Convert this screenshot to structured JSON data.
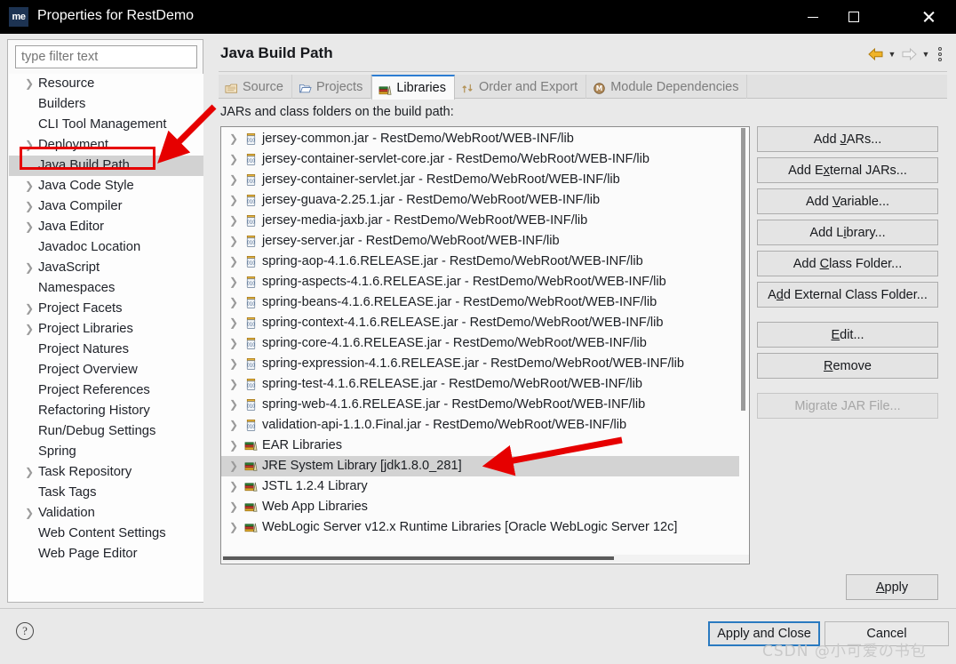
{
  "window": {
    "title": "Properties for RestDemo",
    "icon_label": "me",
    "controls": {
      "minimize": "minimize-icon",
      "maximize": "maximize-icon",
      "close": "close-icon"
    }
  },
  "sidebar": {
    "filter_placeholder": "type filter text",
    "items": [
      {
        "label": "Resource",
        "expandable": true,
        "selected": false
      },
      {
        "label": "Builders",
        "expandable": false,
        "selected": false
      },
      {
        "label": "CLI Tool Management",
        "expandable": false,
        "selected": false
      },
      {
        "label": "Deployment",
        "expandable": true,
        "selected": false
      },
      {
        "label": "Java Build Path",
        "expandable": false,
        "selected": true
      },
      {
        "label": "Java Code Style",
        "expandable": true,
        "selected": false
      },
      {
        "label": "Java Compiler",
        "expandable": true,
        "selected": false
      },
      {
        "label": "Java Editor",
        "expandable": true,
        "selected": false
      },
      {
        "label": "Javadoc Location",
        "expandable": false,
        "selected": false
      },
      {
        "label": "JavaScript",
        "expandable": true,
        "selected": false
      },
      {
        "label": "Namespaces",
        "expandable": false,
        "selected": false
      },
      {
        "label": "Project Facets",
        "expandable": true,
        "selected": false
      },
      {
        "label": "Project Libraries",
        "expandable": true,
        "selected": false
      },
      {
        "label": "Project Natures",
        "expandable": false,
        "selected": false
      },
      {
        "label": "Project Overview",
        "expandable": false,
        "selected": false
      },
      {
        "label": "Project References",
        "expandable": false,
        "selected": false
      },
      {
        "label": "Refactoring History",
        "expandable": false,
        "selected": false
      },
      {
        "label": "Run/Debug Settings",
        "expandable": false,
        "selected": false
      },
      {
        "label": "Spring",
        "expandable": false,
        "selected": false
      },
      {
        "label": "Task Repository",
        "expandable": true,
        "selected": false
      },
      {
        "label": "Task Tags",
        "expandable": false,
        "selected": false
      },
      {
        "label": "Validation",
        "expandable": true,
        "selected": false
      },
      {
        "label": "Web Content Settings",
        "expandable": false,
        "selected": false
      },
      {
        "label": "Web Page Editor",
        "expandable": false,
        "selected": false
      }
    ]
  },
  "main": {
    "page_title": "Java Build Path",
    "nav": {
      "back": "back-arrow-icon",
      "forward": "forward-arrow-icon",
      "menu": "view-menu-icon"
    },
    "tabs": [
      {
        "label": "Source",
        "icon": "source-folder-icon",
        "active": false
      },
      {
        "label": "Projects",
        "icon": "projects-folder-icon",
        "active": false
      },
      {
        "label": "Libraries",
        "icon": "libraries-books-icon",
        "active": true
      },
      {
        "label": "Order and Export",
        "icon": "order-export-icon",
        "active": false
      },
      {
        "label": "Module Dependencies",
        "icon": "module-dependencies-icon",
        "active": false
      }
    ],
    "list_label": "JARs and class folders on the build path:",
    "entries": [
      {
        "label": "jersey-common.jar - RestDemo/WebRoot/WEB-INF/lib",
        "icon": "jar-icon",
        "selected": false
      },
      {
        "label": "jersey-container-servlet-core.jar - RestDemo/WebRoot/WEB-INF/lib",
        "icon": "jar-icon",
        "selected": false
      },
      {
        "label": "jersey-container-servlet.jar - RestDemo/WebRoot/WEB-INF/lib",
        "icon": "jar-icon",
        "selected": false
      },
      {
        "label": "jersey-guava-2.25.1.jar - RestDemo/WebRoot/WEB-INF/lib",
        "icon": "jar-icon",
        "selected": false
      },
      {
        "label": "jersey-media-jaxb.jar - RestDemo/WebRoot/WEB-INF/lib",
        "icon": "jar-icon",
        "selected": false
      },
      {
        "label": "jersey-server.jar - RestDemo/WebRoot/WEB-INF/lib",
        "icon": "jar-icon",
        "selected": false
      },
      {
        "label": "spring-aop-4.1.6.RELEASE.jar - RestDemo/WebRoot/WEB-INF/lib",
        "icon": "jar-icon",
        "selected": false
      },
      {
        "label": "spring-aspects-4.1.6.RELEASE.jar - RestDemo/WebRoot/WEB-INF/lib",
        "icon": "jar-icon",
        "selected": false
      },
      {
        "label": "spring-beans-4.1.6.RELEASE.jar - RestDemo/WebRoot/WEB-INF/lib",
        "icon": "jar-icon",
        "selected": false
      },
      {
        "label": "spring-context-4.1.6.RELEASE.jar - RestDemo/WebRoot/WEB-INF/lib",
        "icon": "jar-icon",
        "selected": false
      },
      {
        "label": "spring-core-4.1.6.RELEASE.jar - RestDemo/WebRoot/WEB-INF/lib",
        "icon": "jar-icon",
        "selected": false
      },
      {
        "label": "spring-expression-4.1.6.RELEASE.jar - RestDemo/WebRoot/WEB-INF/lib",
        "icon": "jar-icon",
        "selected": false
      },
      {
        "label": "spring-test-4.1.6.RELEASE.jar - RestDemo/WebRoot/WEB-INF/lib",
        "icon": "jar-icon",
        "selected": false
      },
      {
        "label": "spring-web-4.1.6.RELEASE.jar - RestDemo/WebRoot/WEB-INF/lib",
        "icon": "jar-icon",
        "selected": false
      },
      {
        "label": "validation-api-1.1.0.Final.jar - RestDemo/WebRoot/WEB-INF/lib",
        "icon": "jar-icon",
        "selected": false
      },
      {
        "label": "EAR Libraries",
        "icon": "library-books-icon",
        "selected": false
      },
      {
        "label": "JRE System Library [jdk1.8.0_281]",
        "icon": "library-books-icon",
        "selected": true
      },
      {
        "label": "JSTL 1.2.4 Library",
        "icon": "library-books-icon",
        "selected": false
      },
      {
        "label": "Web App Libraries",
        "icon": "library-books-icon",
        "selected": false
      },
      {
        "label": "WebLogic Server v12.x Runtime Libraries [Oracle WebLogic Server 12c]",
        "icon": "library-books-icon",
        "selected": false
      }
    ],
    "side_buttons": [
      {
        "label": "Add JARs...",
        "mnemonic": "J",
        "enabled": true
      },
      {
        "label": "Add External JARs...",
        "mnemonic": "x",
        "enabled": true
      },
      {
        "label": "Add Variable...",
        "mnemonic": "V",
        "enabled": true
      },
      {
        "label": "Add Library...",
        "mnemonic": "i",
        "enabled": true
      },
      {
        "label": "Add Class Folder...",
        "mnemonic": "C",
        "enabled": true
      },
      {
        "label": "Add External Class Folder...",
        "mnemonic": "d",
        "enabled": true
      },
      {
        "label": "Edit...",
        "mnemonic": "E",
        "enabled": true
      },
      {
        "label": "Remove",
        "mnemonic": "R",
        "enabled": true
      },
      {
        "label": "Migrate JAR File...",
        "mnemonic": "",
        "enabled": false
      }
    ],
    "apply_button": {
      "label": "Apply",
      "mnemonic": "A"
    }
  },
  "footer": {
    "help_icon": "help-icon",
    "apply_and_close": "Apply and Close",
    "cancel": "Cancel"
  },
  "watermark": "CSDN @小可爱の书包",
  "colors": {
    "accent_focus": "#2a7ac0",
    "annotation_red": "#e60000",
    "selection_gray": "#d3d3d3",
    "titlebar": "#000000"
  }
}
